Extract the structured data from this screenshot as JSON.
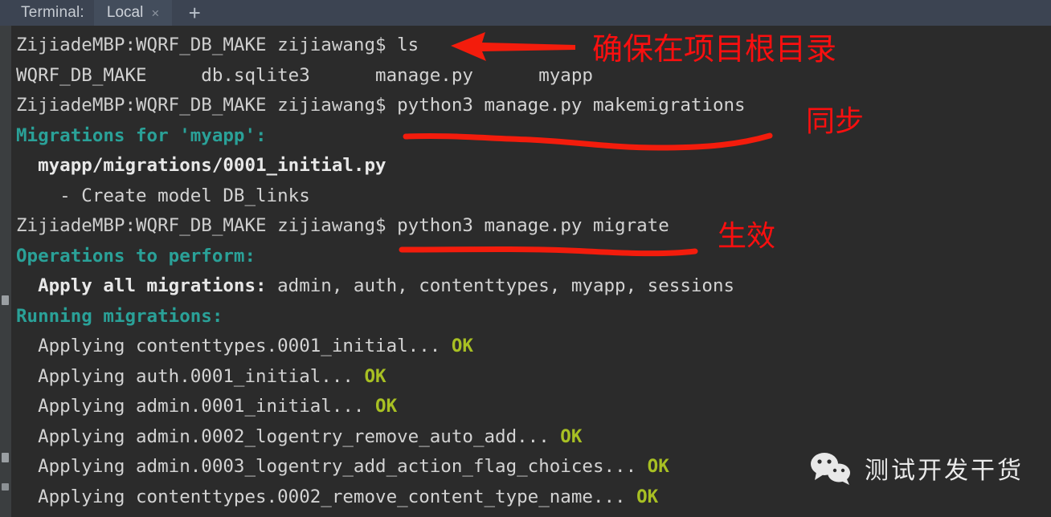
{
  "tabbar": {
    "terminal_label": "Terminal:",
    "active_tab": "Local",
    "close_icon": "×",
    "add_icon": "+"
  },
  "terminal": {
    "prompt": "ZijiadeMBP:WQRF_DB_MAKE zijiawang$ ",
    "lines": [
      {
        "id": "l1",
        "prompt": "ZijiadeMBP:WQRF_DB_MAKE zijiawang$ ",
        "cmd": "ls"
      },
      {
        "id": "l2",
        "text": "WQRF_DB_MAKE     db.sqlite3      manage.py      myapp"
      },
      {
        "id": "l3",
        "prompt": "ZijiadeMBP:WQRF_DB_MAKE zijiawang$ ",
        "cmd": "python3 manage.py makemigrations"
      },
      {
        "id": "l4",
        "cyan": "Migrations for 'myapp':"
      },
      {
        "id": "l5",
        "bold": "  myapp/migrations/0001_initial.py"
      },
      {
        "id": "l6",
        "text": "    - Create model DB_links"
      },
      {
        "id": "l7",
        "prompt": "ZijiadeMBP:WQRF_DB_MAKE zijiawang$ ",
        "cmd": "python3 manage.py migrate"
      },
      {
        "id": "l8",
        "cyan": "Operations to perform:"
      },
      {
        "id": "l9",
        "bold": "  Apply all migrations:",
        "text": " admin, auth, contenttypes, myapp, sessions"
      },
      {
        "id": "l10",
        "cyan": "Running migrations:"
      },
      {
        "id": "l11",
        "text": "  Applying contenttypes.0001_initial...",
        "ok": " OK"
      },
      {
        "id": "l12",
        "text": "  Applying auth.0001_initial...",
        "ok": " OK"
      },
      {
        "id": "l13",
        "text": "  Applying admin.0001_initial...",
        "ok": " OK"
      },
      {
        "id": "l14",
        "text": "  Applying admin.0002_logentry_remove_auto_add...",
        "ok": " OK"
      },
      {
        "id": "l15",
        "text": "  Applying admin.0003_logentry_add_action_flag_choices...",
        "ok": " OK"
      },
      {
        "id": "l16",
        "text": "  Applying contenttypes.0002_remove_content_type_name...",
        "ok": " OK"
      }
    ]
  },
  "annotations": {
    "color": "#fa0f0f",
    "arrow_note": "确保在项目根目录",
    "sync_note": "同步",
    "effect_note": "生效"
  },
  "watermark": {
    "text": "测试开发干货"
  }
}
